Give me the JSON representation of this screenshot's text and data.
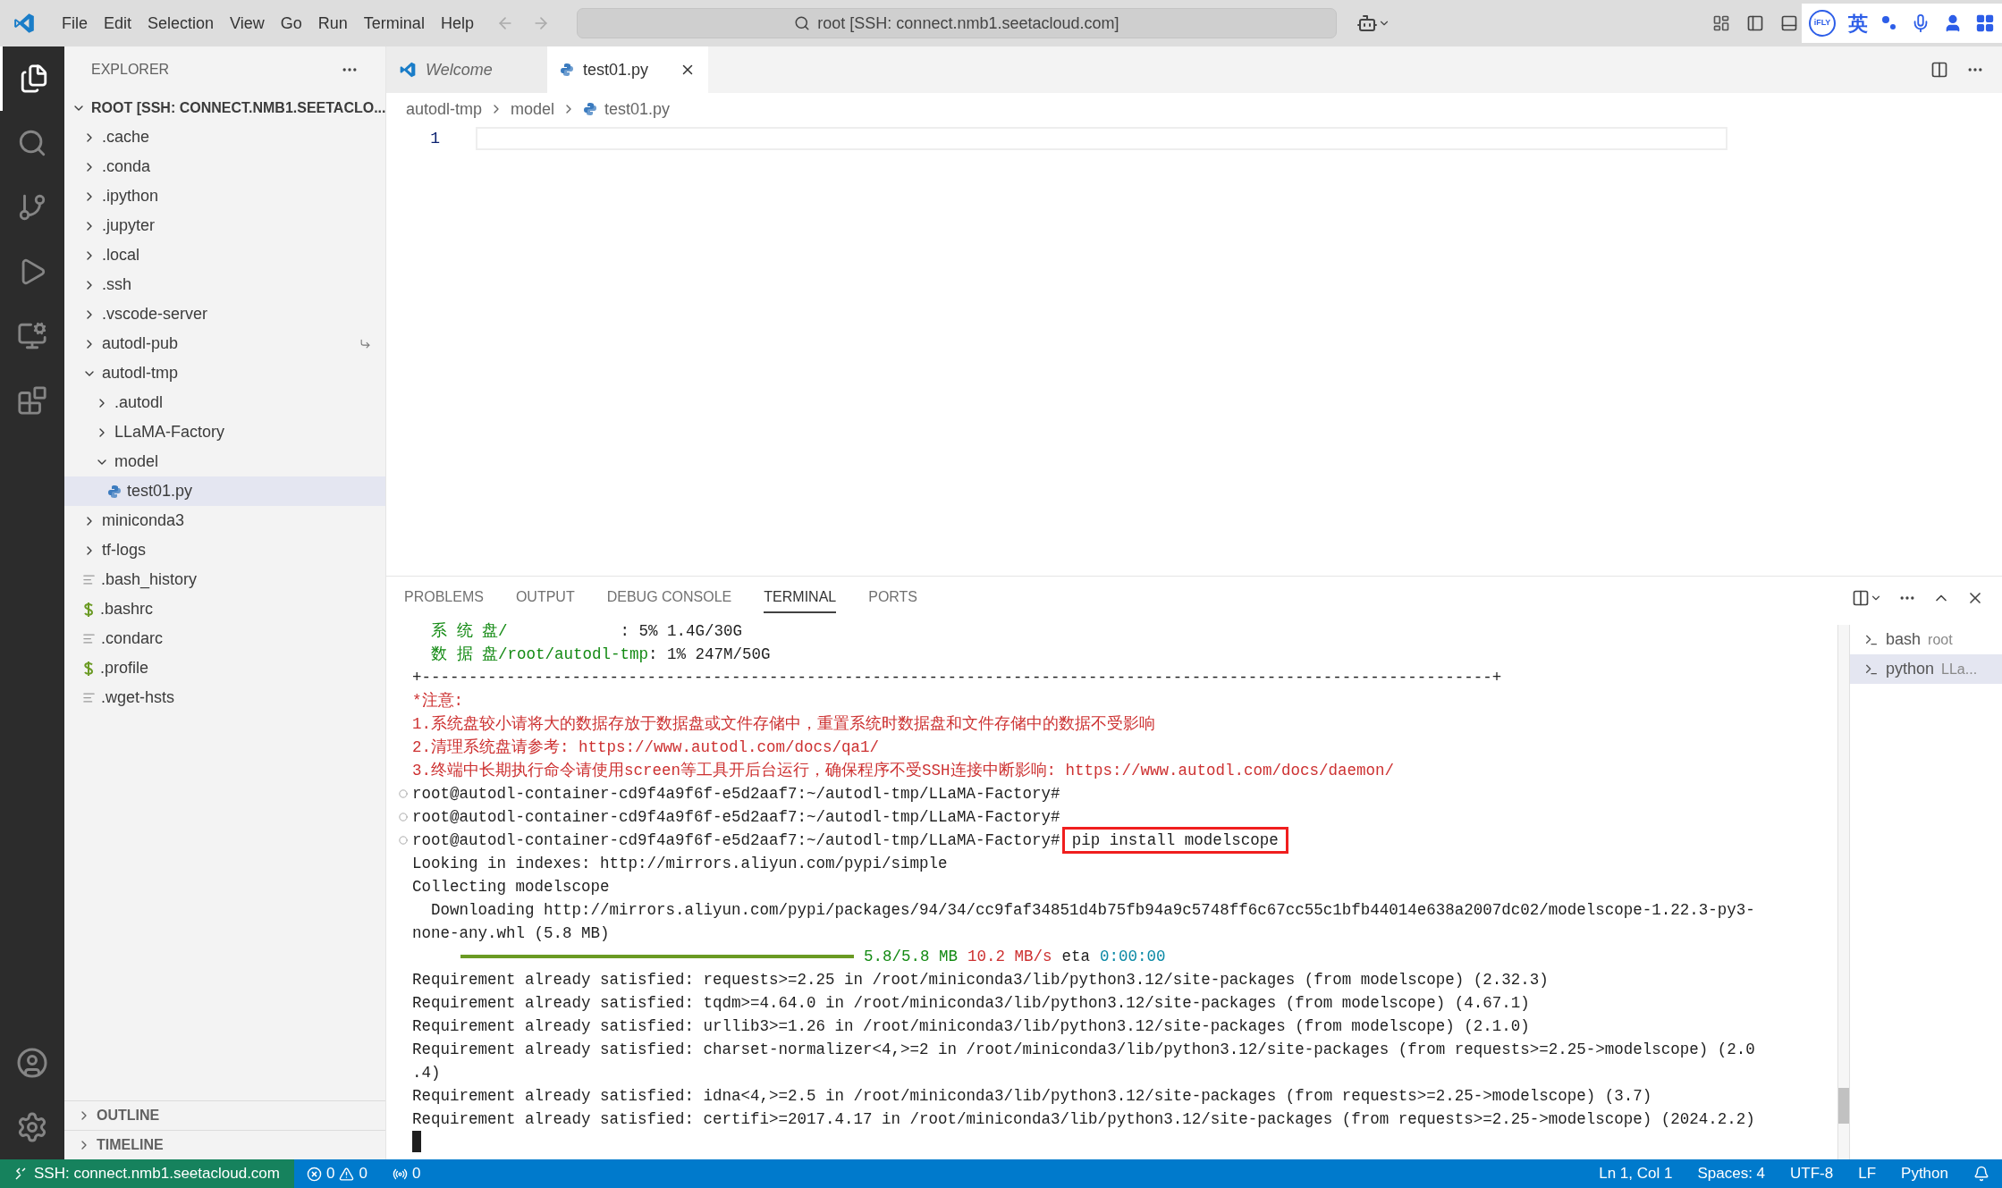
{
  "menu": [
    "File",
    "Edit",
    "Selection",
    "View",
    "Go",
    "Run",
    "Terminal",
    "Help"
  ],
  "command_center": {
    "text": "root [SSH: connect.nmb1.seetacloud.com]"
  },
  "ime": {
    "badge": "iFLY",
    "lang": "英"
  },
  "sidebar": {
    "title": "EXPLORER",
    "root": "ROOT [SSH: CONNECT.NMB1.SEETACLO...",
    "items": [
      {
        "label": ".cache",
        "kind": "folder",
        "expanded": false,
        "selected": false
      },
      {
        "label": ".conda",
        "kind": "folder",
        "expanded": false,
        "selected": false
      },
      {
        "label": ".ipython",
        "kind": "folder",
        "expanded": false,
        "selected": false
      },
      {
        "label": ".jupyter",
        "kind": "folder",
        "expanded": false,
        "selected": false
      },
      {
        "label": ".local",
        "kind": "folder",
        "expanded": false,
        "selected": false
      },
      {
        "label": ".ssh",
        "kind": "folder",
        "expanded": false,
        "selected": false
      },
      {
        "label": ".vscode-server",
        "kind": "folder",
        "expanded": false,
        "selected": false
      },
      {
        "label": "autodl-pub",
        "kind": "symlink",
        "expanded": false,
        "selected": false
      },
      {
        "label": "autodl-tmp",
        "kind": "folder",
        "expanded": true,
        "selected": false,
        "children": [
          {
            "label": ".autodl",
            "kind": "folder",
            "expanded": false,
            "selected": false
          },
          {
            "label": "LLaMA-Factory",
            "kind": "folder",
            "expanded": false,
            "selected": false
          },
          {
            "label": "model",
            "kind": "folder",
            "expanded": true,
            "selected": false,
            "children": [
              {
                "label": "test01.py",
                "kind": "python",
                "selected": true
              }
            ]
          }
        ]
      },
      {
        "label": "miniconda3",
        "kind": "folder",
        "expanded": false,
        "selected": false
      },
      {
        "label": "tf-logs",
        "kind": "folder",
        "expanded": false,
        "selected": false
      },
      {
        "label": ".bash_history",
        "kind": "text",
        "selected": false
      },
      {
        "label": ".bashrc",
        "kind": "shell",
        "selected": false
      },
      {
        "label": ".condarc",
        "kind": "text",
        "selected": false
      },
      {
        "label": ".profile",
        "kind": "shell",
        "selected": false
      },
      {
        "label": ".wget-hsts",
        "kind": "text",
        "selected": false
      }
    ],
    "sections": [
      "OUTLINE",
      "TIMELINE"
    ]
  },
  "tabs": [
    {
      "label": "Welcome",
      "kind": "welcome",
      "selected": false
    },
    {
      "label": "test01.py",
      "kind": "python",
      "selected": true
    }
  ],
  "breadcrumb": [
    "autodl-tmp",
    "model",
    "test01.py"
  ],
  "editor": {
    "line_numbers": [
      "1"
    ]
  },
  "panel": {
    "tabs": [
      {
        "label": "PROBLEMS",
        "selected": false
      },
      {
        "label": "OUTPUT",
        "selected": false
      },
      {
        "label": "DEBUG CONSOLE",
        "selected": false
      },
      {
        "label": "TERMINAL",
        "selected": true
      },
      {
        "label": "PORTS",
        "selected": false
      }
    ],
    "terminals": [
      {
        "name": "bash",
        "detail": "root",
        "selected": false
      },
      {
        "name": "python",
        "detail": "LLa...",
        "selected": true
      }
    ],
    "lines": [
      {
        "kind": "text",
        "segments": [
          {
            "text": "  系 统 盘/",
            "color": "#138a13"
          },
          {
            "text": "            : 5% 1.4G/30G",
            "color": "#1f1f1f"
          }
        ]
      },
      {
        "kind": "text",
        "segments": [
          {
            "text": "  数 据 盘/root/autodl-tmp",
            "color": "#138a13"
          },
          {
            "text": ": 1% 247M/50G",
            "color": "#1f1f1f"
          }
        ]
      },
      {
        "kind": "text",
        "segments": [
          {
            "text": "+------------------------------------------------------------------------------------------------------------------+",
            "color": "#1f1f1f"
          }
        ]
      },
      {
        "kind": "text",
        "segments": [
          {
            "text": "*注意:",
            "color": "#cd3131"
          }
        ]
      },
      {
        "kind": "text",
        "segments": [
          {
            "text": "1.系统盘较小请将大的数据存放于数据盘或文件存储中，重置系统时数据盘和文件存储中的数据不受影响",
            "color": "#cd3131"
          }
        ]
      },
      {
        "kind": "text",
        "segments": [
          {
            "text": "2.清理系统盘请参考: https://www.autodl.com/docs/qa1/",
            "color": "#cd3131"
          }
        ]
      },
      {
        "kind": "text",
        "segments": [
          {
            "text": "3.终端中长期执行命令请使用screen等工具开后台运行，确保程序不受SSH连接中断影响: https://www.autodl.com/docs/daemon/",
            "color": "#cd3131"
          }
        ]
      },
      {
        "kind": "prompt",
        "prompt": "root@autodl-container-cd9f4a9f6f-e5d2aaf7:~/autodl-tmp/LLaMA-Factory#"
      },
      {
        "kind": "prompt",
        "prompt": "root@autodl-container-cd9f4a9f6f-e5d2aaf7:~/autodl-tmp/LLaMA-Factory#"
      },
      {
        "kind": "prompt",
        "prompt": "root@autodl-container-cd9f4a9f6f-e5d2aaf7:~/autodl-tmp/LLaMA-Factory#",
        "command": "pip install modelscope",
        "highlighted": true
      },
      {
        "kind": "text",
        "segments": [
          {
            "text": "Looking in indexes: http://mirrors.aliyun.com/pypi/simple",
            "color": "#1f1f1f"
          }
        ]
      },
      {
        "kind": "text",
        "segments": [
          {
            "text": "Collecting modelscope",
            "color": "#1f1f1f"
          }
        ]
      },
      {
        "kind": "text",
        "segments": [
          {
            "text": "  Downloading http://mirrors.aliyun.com/pypi/packages/94/34/cc9faf34851d4b75fb94a9c5748ff6c67cc55c1bfb44014e638a2007dc02/modelscope-1.22.3-py3-",
            "color": "#1f1f1f"
          }
        ]
      },
      {
        "kind": "text",
        "segments": [
          {
            "text": "none-any.whl (5.8 MB)",
            "color": "#1f1f1f"
          }
        ]
      },
      {
        "kind": "progress",
        "level": 1,
        "segments": [
          {
            "text": "5.8/5.8 MB",
            "color": "#138a13"
          },
          {
            "text": "10.2 MB/s",
            "color": "#cd3131"
          },
          {
            "text": "eta",
            "color": "#1f1f1f"
          },
          {
            "text": "0:00:00",
            "color": "#0b8aa6"
          }
        ]
      },
      {
        "kind": "text",
        "segments": [
          {
            "text": "Requirement already satisfied: requests>=2.25 in /root/miniconda3/lib/python3.12/site-packages (from modelscope) (2.32.3)",
            "color": "#1f1f1f"
          }
        ]
      },
      {
        "kind": "text",
        "segments": [
          {
            "text": "Requirement already satisfied: tqdm>=4.64.0 in /root/miniconda3/lib/python3.12/site-packages (from modelscope) (4.67.1)",
            "color": "#1f1f1f"
          }
        ]
      },
      {
        "kind": "text",
        "segments": [
          {
            "text": "Requirement already satisfied: urllib3>=1.26 in /root/miniconda3/lib/python3.12/site-packages (from modelscope) (2.1.0)",
            "color": "#1f1f1f"
          }
        ]
      },
      {
        "kind": "text",
        "segments": [
          {
            "text": "Requirement already satisfied: charset-normalizer<4,>=2 in /root/miniconda3/lib/python3.12/site-packages (from requests>=2.25->modelscope) (2.0",
            "color": "#1f1f1f"
          }
        ]
      },
      {
        "kind": "text",
        "segments": [
          {
            "text": ".4)",
            "color": "#1f1f1f"
          }
        ]
      },
      {
        "kind": "text",
        "segments": [
          {
            "text": "Requirement already satisfied: idna<4,>=2.5 in /root/miniconda3/lib/python3.12/site-packages (from requests>=2.25->modelscope) (3.7)",
            "color": "#1f1f1f"
          }
        ]
      },
      {
        "kind": "text",
        "segments": [
          {
            "text": "Requirement already satisfied: certifi>=2017.4.17 in /root/miniconda3/lib/python3.12/site-packages (from requests>=2.25->modelscope) (2024.2.2)",
            "color": "#1f1f1f"
          }
        ]
      },
      {
        "kind": "cursor"
      }
    ]
  },
  "status_bar": {
    "remote": "SSH: connect.nmb1.seetacloud.com",
    "errors": "0",
    "warnings": "0",
    "ports": "0",
    "right": [
      "Ln 1, Col 1",
      "Spaces: 4",
      "UTF-8",
      "LF",
      "Python"
    ]
  }
}
